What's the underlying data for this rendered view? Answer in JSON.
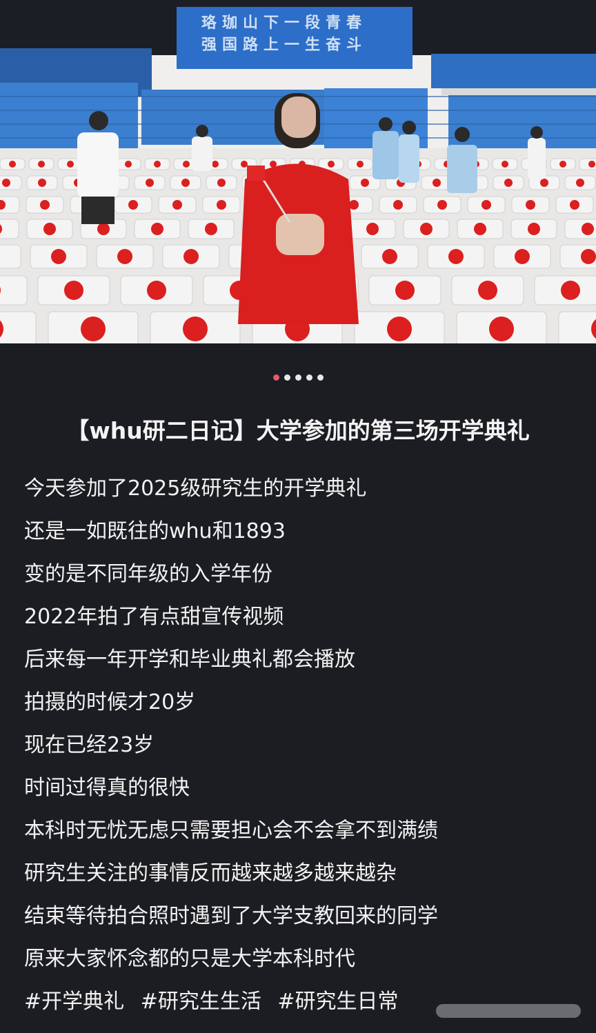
{
  "photo": {
    "banner": {
      "line1": "珞珈山下一段青春",
      "line2": "强国路上一生奋斗"
    },
    "colors": {
      "seat_blue": "#3b7fd0",
      "chair_white": "#f4f4f4",
      "chair_dot": "#dc1f1f",
      "shirt_red": "#d9201f"
    }
  },
  "carousel": {
    "count": 5,
    "active_index": 0
  },
  "post": {
    "title": "【whu研二日记】大学参加的第三场开学典礼",
    "lines": [
      "今天参加了2025级研究生的开学典礼",
      "还是一如既往的whu和1893",
      "变的是不同年级的入学年份",
      "2022年拍了有点甜宣传视频",
      "后来每一年开学和毕业典礼都会播放",
      "拍摄的时候才20岁",
      "现在已经23岁",
      "时间过得真的很快",
      "本科时无忧无虑只需要担心会不会拿不到满绩",
      "研究生关注的事情反而越来越多越来越杂",
      "结束等待拍合照时遇到了大学支教回来的同学",
      "原来大家怀念都的只是大学本科时代"
    ],
    "tags": [
      "#开学典礼",
      "#研究生生活",
      "#研究生日常"
    ]
  }
}
